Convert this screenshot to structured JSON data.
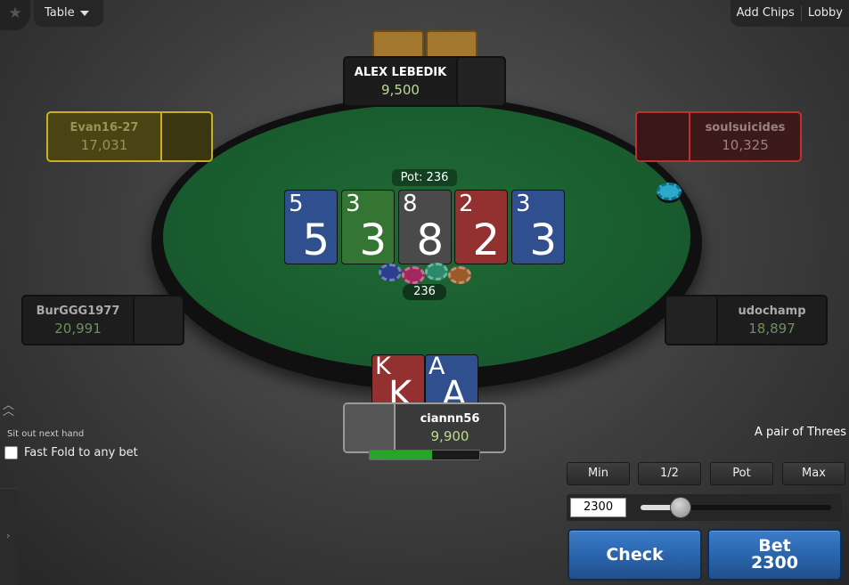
{
  "topbar": {
    "table_label": "Table",
    "add_chips": "Add Chips",
    "lobby": "Lobby"
  },
  "players": {
    "top": {
      "name": "ALEX LEBEDIK",
      "stack": "9,500"
    },
    "left_upper": {
      "name": "Evan16-27",
      "stack": "17,031"
    },
    "right_upper": {
      "name": "soulsuicides",
      "stack": "10,325"
    },
    "left_lower": {
      "name": "BurGGG1977",
      "stack": "20,991"
    },
    "right_lower": {
      "name": "udochamp",
      "stack": "18,897"
    },
    "hero": {
      "name": "ciannn56",
      "stack": "9,900"
    }
  },
  "pot": {
    "label": "Pot: 236",
    "amount": "236"
  },
  "board": [
    {
      "rank": "5",
      "color": "blue"
    },
    {
      "rank": "3",
      "color": "green"
    },
    {
      "rank": "8",
      "color": "dark"
    },
    {
      "rank": "2",
      "color": "red"
    },
    {
      "rank": "3",
      "color": "blue"
    }
  ],
  "hero_cards": [
    {
      "rank": "K",
      "color": "red"
    },
    {
      "rank": "A",
      "color": "blue"
    }
  ],
  "controls": {
    "sit_out": "Sit out next hand",
    "fast_fold": "Fast Fold to any bet",
    "hand_description": "A pair of Threes",
    "quick_bets": [
      "Min",
      "1/2",
      "Pot",
      "Max"
    ],
    "bet_value": "2300",
    "slider_fraction": 0.21,
    "timer_fraction": 0.57,
    "check_label": "Check",
    "bet_label": "Bet",
    "bet_amount": "2300"
  },
  "icons": {
    "corner": "star-icon",
    "table_menu": "caret-down-icon",
    "expand": "double-chevron-up-icon",
    "sidebar": "chevron-right-icon",
    "dealer": "dealer-button-icon"
  },
  "colors": {
    "felt": "#185a2d",
    "acting_seat": "#c8b11e",
    "folded_seat": "#c03030",
    "action_button": "#2a63ab"
  }
}
